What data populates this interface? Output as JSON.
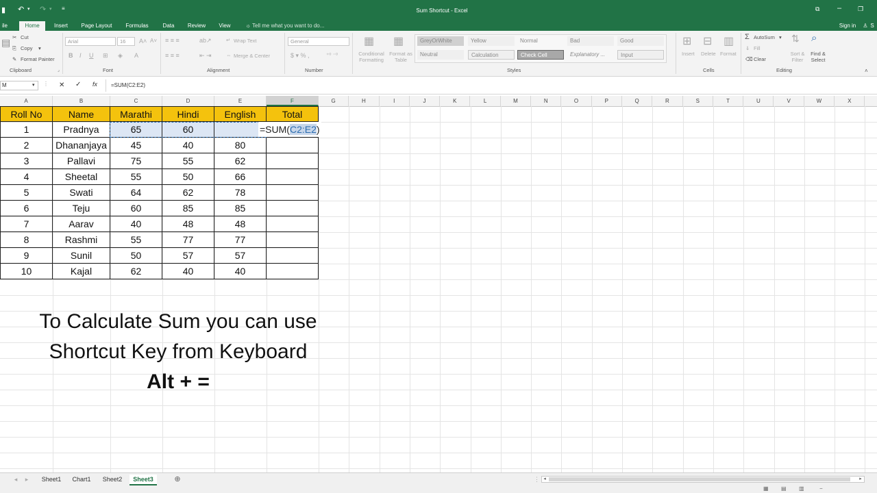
{
  "app": {
    "title": "Sum Shortcut - Excel",
    "sign_in": "Sign in",
    "share": "S"
  },
  "tabs": [
    "ile",
    "Home",
    "Insert",
    "Page Layout",
    "Formulas",
    "Data",
    "Review",
    "View"
  ],
  "tell_me": "Tell me what you want to do...",
  "ribbon": {
    "clipboard": {
      "cut": "Cut",
      "copy": "Copy",
      "format_painter": "Format Painter",
      "label": "Clipboard"
    },
    "font": {
      "name": "Arial",
      "size": "16",
      "bold": "B",
      "italic": "I",
      "underline": "U",
      "label": "Font"
    },
    "alignment": {
      "wrap_text": "Wrap Text",
      "merge_center": "Merge & Center",
      "label": "Alignment"
    },
    "number": {
      "format": "General",
      "label": "Number"
    },
    "styles": {
      "conditional_formatting": "Conditional Formatting",
      "format_as_table": "Format as Table",
      "cells": [
        "GreyOrWhite",
        "Yellow",
        "Normal",
        "Bad",
        "Good",
        "Neutral",
        "Calculation",
        "Check Cell",
        "Explanatory ...",
        "Input"
      ],
      "label": "Styles"
    },
    "cells": {
      "insert": "Insert",
      "delete": "Delete",
      "format": "Format",
      "label": "Cells"
    },
    "editing": {
      "autosum": "AutoSum",
      "fill": "Fill",
      "clear": "Clear",
      "sort_filter": "Sort & Filter",
      "find_select": "Find & Select",
      "label": "Editing"
    }
  },
  "formula_bar": {
    "name_box": "M",
    "cancel": "✕",
    "enter": "✓",
    "fx": "fx",
    "formula": "=SUM(C2:E2)"
  },
  "columns": [
    "A",
    "B",
    "C",
    "D",
    "E",
    "F",
    "G",
    "H",
    "I",
    "J",
    "K",
    "L",
    "M",
    "N",
    "O",
    "P",
    "Q",
    "R",
    "S",
    "T",
    "U",
    "V",
    "W",
    "X"
  ],
  "table": {
    "headers": [
      "Roll No",
      "Name",
      "Marathi",
      "Hindi",
      "English",
      "Total"
    ],
    "rows": [
      [
        "1",
        "Pradnya",
        "65",
        "60",
        "",
        "=SUM(C2:E2)"
      ],
      [
        "2",
        "Dhananjaya",
        "45",
        "40",
        "80",
        ""
      ],
      [
        "3",
        "Pallavi",
        "75",
        "55",
        "62",
        ""
      ],
      [
        "4",
        "Sheetal",
        "55",
        "50",
        "66",
        ""
      ],
      [
        "5",
        "Swati",
        "64",
        "62",
        "78",
        ""
      ],
      [
        "6",
        "Teju",
        "60",
        "85",
        "85",
        ""
      ],
      [
        "7",
        "Aarav",
        "40",
        "48",
        "48",
        ""
      ],
      [
        "8",
        "Rashmi",
        "55",
        "77",
        "77",
        ""
      ],
      [
        "9",
        "Sunil",
        "50",
        "57",
        "57",
        ""
      ],
      [
        "10",
        "Kajal",
        "62",
        "40",
        "40",
        ""
      ]
    ]
  },
  "formula_parts": {
    "prefix": "=SUM(",
    "ref": "C2:E2",
    "suffix": ")"
  },
  "overlay": {
    "line1": "To Calculate Sum you can use",
    "line2": "Shortcut Key from Keyboard",
    "line3": "Alt + ="
  },
  "sheets": [
    "Sheet1",
    "Chart1",
    "Sheet2",
    "Sheet3"
  ],
  "active_sheet": "Sheet3",
  "colors": {
    "excel_green": "#217346",
    "header_yellow": "#f4c20d",
    "selection": "#dce6f4"
  }
}
